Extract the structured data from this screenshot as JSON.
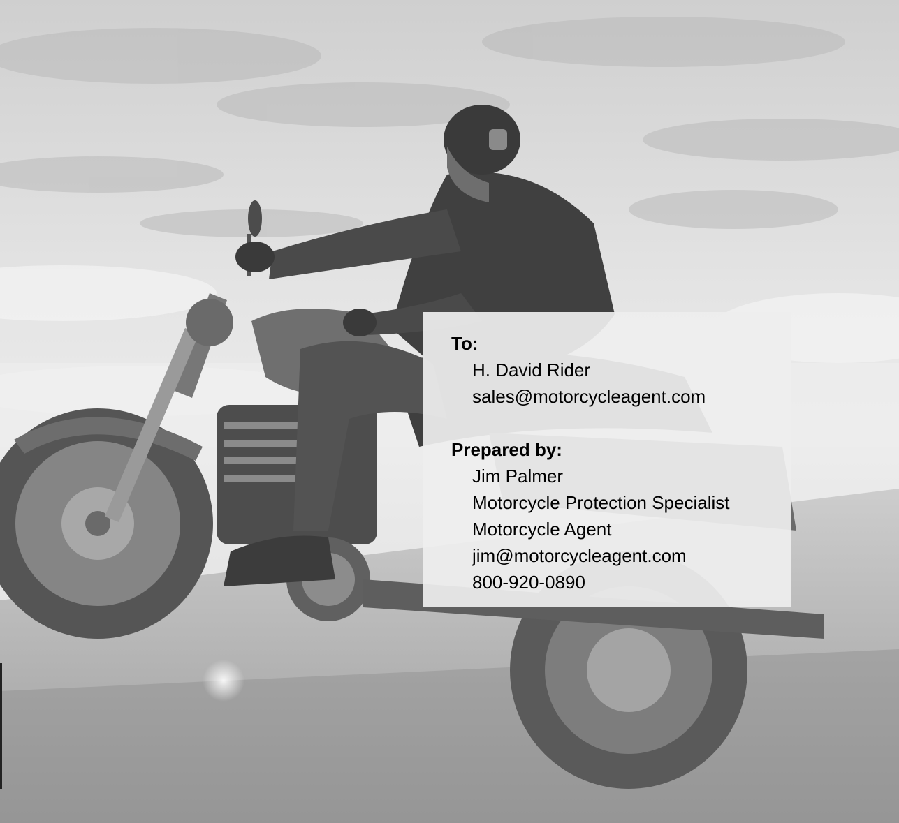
{
  "recipient": {
    "heading": "To:",
    "name": "H. David Rider",
    "email": "sales@motorcycleagent.com"
  },
  "preparer": {
    "heading": "Prepared by:",
    "name": "Jim Palmer",
    "title": "Motorcycle Protection Specialist",
    "company": "Motorcycle Agent",
    "email": "jim@motorcycleagent.com",
    "phone": "800-920-0890"
  }
}
